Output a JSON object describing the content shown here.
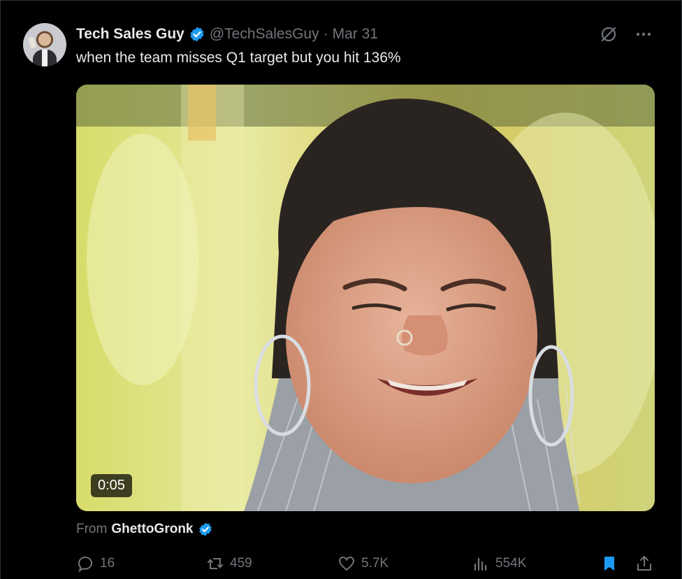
{
  "tweet": {
    "display_name": "Tech Sales Guy",
    "handle": "@TechSalesGuy",
    "separator": "·",
    "date": "Mar 31",
    "text": "when the team misses Q1 target but you hit 136%",
    "icons": {
      "verified": "verified-badge-icon",
      "grok": "grok-icon",
      "more": "more-icon"
    }
  },
  "media": {
    "type": "video",
    "duration": "0:05",
    "colors": {
      "background": "#d8d95a",
      "skin": "#d99a7e",
      "hair": "#2a2421"
    }
  },
  "source": {
    "prefix": "From",
    "name": "GhettoGronk"
  },
  "actions": {
    "replies": "16",
    "reposts": "459",
    "likes": "5.7K",
    "views": "554K",
    "icons": [
      "reply-icon",
      "repost-icon",
      "like-icon",
      "views-icon",
      "bookmark-icon",
      "share-icon"
    ]
  },
  "colors": {
    "background": "#000000",
    "text": "#e7e9ea",
    "muted": "#71767b",
    "accent": "#1d9bf0",
    "border": "#2f3336"
  }
}
